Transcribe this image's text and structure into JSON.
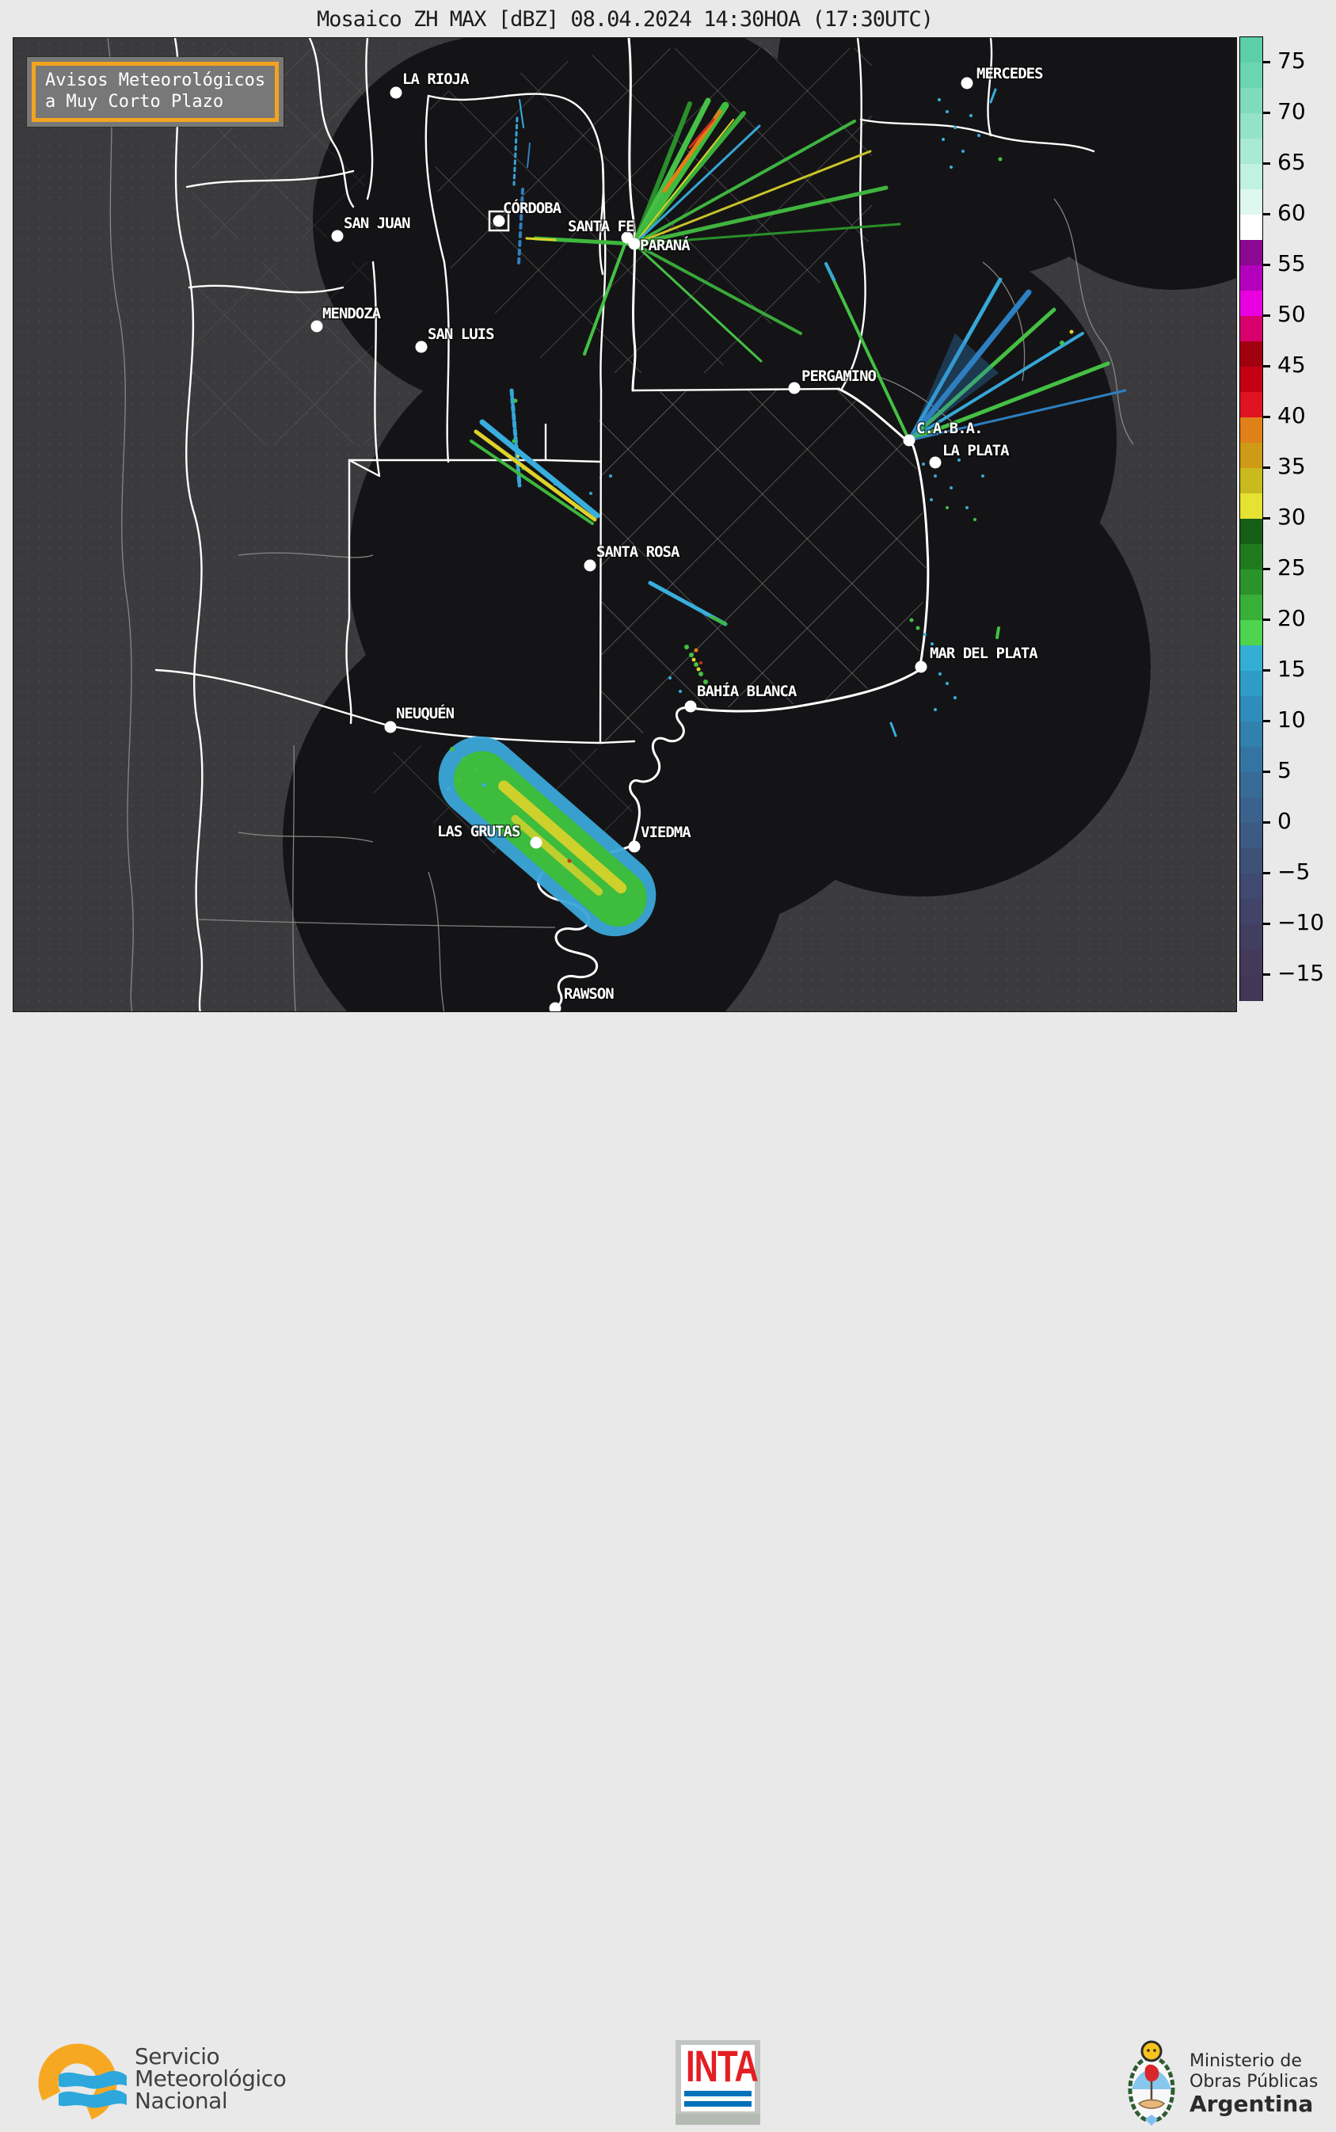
{
  "title": "Mosaico ZH MAX [dBZ] 08.04.2024 14:30HOA (17:30UTC)",
  "warning_box": {
    "line1": "Avisos Meteorológicos",
    "line2": "a Muy Corto Plazo",
    "border_color": "#f2a41f"
  },
  "colorbar": {
    "unit": "dBZ",
    "tick_values": [
      75,
      70,
      65,
      60,
      55,
      50,
      45,
      40,
      35,
      30,
      25,
      20,
      15,
      10,
      5,
      0,
      -5,
      -10,
      -15
    ],
    "top_dbz": 77.5,
    "bottom_dbz": -17.5,
    "cell_step_dbz": 2.5,
    "cell_colors_top_to_bottom": [
      "#5dcfa8",
      "#6bd5b1",
      "#7edcbc",
      "#93e3c8",
      "#a9ead4",
      "#c1f1e1",
      "#dff8ef",
      "#ffffff",
      "#8a0892",
      "#b400bc",
      "#e800e0",
      "#d8006c",
      "#a00010",
      "#c40014",
      "#e01420",
      "#e08018",
      "#cf9a16",
      "#c9bb1e",
      "#e6e232",
      "#175e17",
      "#1f7a1f",
      "#2a942a",
      "#38b038",
      "#4ed44e",
      "#35aed6",
      "#2f9cc8",
      "#2e8dbc",
      "#3180ae",
      "#3474a2",
      "#376b96",
      "#3a628c",
      "#3c5a82",
      "#3e5278",
      "#404a70",
      "#414368",
      "#423e60",
      "#433a5a",
      "#443656"
    ]
  },
  "map": {
    "background_color": "#3b3b3d",
    "radar_coverage_color": "#141416",
    "province_border_color": "#ffffff",
    "department_border_color": "#8f8f8f",
    "city_marker_color": "#ffffff"
  },
  "cities": [
    {
      "id": "mercedes",
      "name": "MERCEDES",
      "dot": [
        1220,
        104
      ],
      "label": [
        1232,
        98
      ]
    },
    {
      "id": "la-rioja",
      "name": "LA RIOJA",
      "dot": [
        499,
        116
      ],
      "label": [
        507,
        105
      ]
    },
    {
      "id": "san-juan",
      "name": "SAN JUAN",
      "dot": [
        425,
        297
      ],
      "label": [
        433,
        287
      ]
    },
    {
      "id": "cordoba",
      "name": "CÓRDOBA",
      "dot": [
        629,
        278
      ],
      "label": [
        634,
        268
      ],
      "marker": "square"
    },
    {
      "id": "santa-fe",
      "name": "SANTA FE",
      "dot": [
        791,
        299
      ],
      "label": [
        716,
        291
      ]
    },
    {
      "id": "parana",
      "name": "PARANÁ",
      "dot": [
        800,
        307
      ],
      "label": [
        807,
        315
      ]
    },
    {
      "id": "mendoza",
      "name": "MENDOZA",
      "dot": [
        399,
        411
      ],
      "label": [
        406,
        401
      ]
    },
    {
      "id": "san-luis",
      "name": "SAN LUIS",
      "dot": [
        531,
        437
      ],
      "label": [
        539,
        427
      ]
    },
    {
      "id": "pergamino",
      "name": "PERGAMINO",
      "dot": [
        1002,
        489
      ],
      "label": [
        1011,
        480
      ]
    },
    {
      "id": "caba",
      "name": "C.A.B.A.",
      "dot": [
        1147,
        555
      ],
      "label": [
        1156,
        546
      ]
    },
    {
      "id": "la-plata",
      "name": "LA PLATA",
      "dot": [
        1180,
        583
      ],
      "label": [
        1189,
        574
      ]
    },
    {
      "id": "santa-rosa",
      "name": "SANTA ROSA",
      "dot": [
        744,
        713
      ],
      "label": [
        752,
        702
      ]
    },
    {
      "id": "mar-del-plata",
      "name": "MAR DEL PLATA",
      "dot": [
        1162,
        841
      ],
      "label": [
        1173,
        830
      ]
    },
    {
      "id": "bahia-blanca",
      "name": "BAHÍA BLANCA",
      "dot": [
        871,
        891
      ],
      "label": [
        879,
        878
      ]
    },
    {
      "id": "neuquen",
      "name": "NEUQUÉN",
      "dot": [
        492,
        917
      ],
      "label": [
        499,
        906
      ]
    },
    {
      "id": "las-grutas",
      "name": "LAS GRUTAS",
      "dot": [
        676,
        1063
      ],
      "label": [
        551,
        1055
      ]
    },
    {
      "id": "viedma",
      "name": "VIEDMA",
      "dot": [
        800,
        1068
      ],
      "label": [
        808,
        1056
      ]
    },
    {
      "id": "rawson",
      "name": "RAWSON",
      "dot": [
        700,
        1272
      ],
      "label": [
        711,
        1260
      ]
    }
  ],
  "footer": {
    "smn": {
      "line1": "Servicio",
      "line2": "Meteorológico",
      "line3": "Nacional"
    },
    "inta": {
      "acronym": "INTA"
    },
    "ministry": {
      "line1": "Ministerio de",
      "line2": "Obras Públicas",
      "line3": "Argentina"
    }
  }
}
